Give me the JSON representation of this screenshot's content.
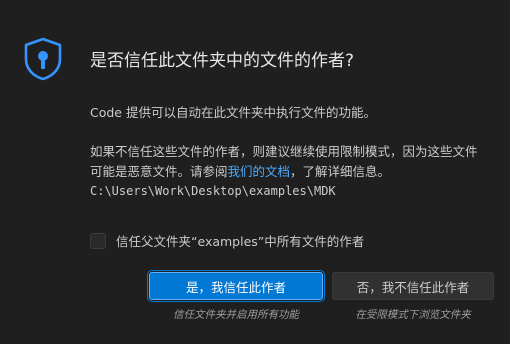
{
  "dialog": {
    "title": "是否信任此文件夹中的文件的作者?",
    "icon": "shield-lock-icon",
    "accent_color": "#0078d4",
    "link_color": "#4daafc",
    "description": "Code 提供可以自动在此文件夹中执行文件的功能。",
    "warning_prefix": "如果不信任这些文件的作者，则建议继续使用限制模式，因为这些文件",
    "warning_line2_prefix": "可能是恶意文件。请参阅",
    "warning_link": "我们的文档",
    "warning_suffix": "，了解详细信息。",
    "folder_path": "C:\\Users\\Work\\Desktop\\examples\\MDK",
    "checkbox_label": "信任父文件夹“examples”中所有文件的作者",
    "checkbox_checked": false,
    "trust_button": "是，我信任此作者",
    "trust_hint": "信任文件夹并启用所有功能",
    "distrust_button": "否，我不信任此作者",
    "distrust_hint": "在受限模式下浏览文件夹"
  }
}
